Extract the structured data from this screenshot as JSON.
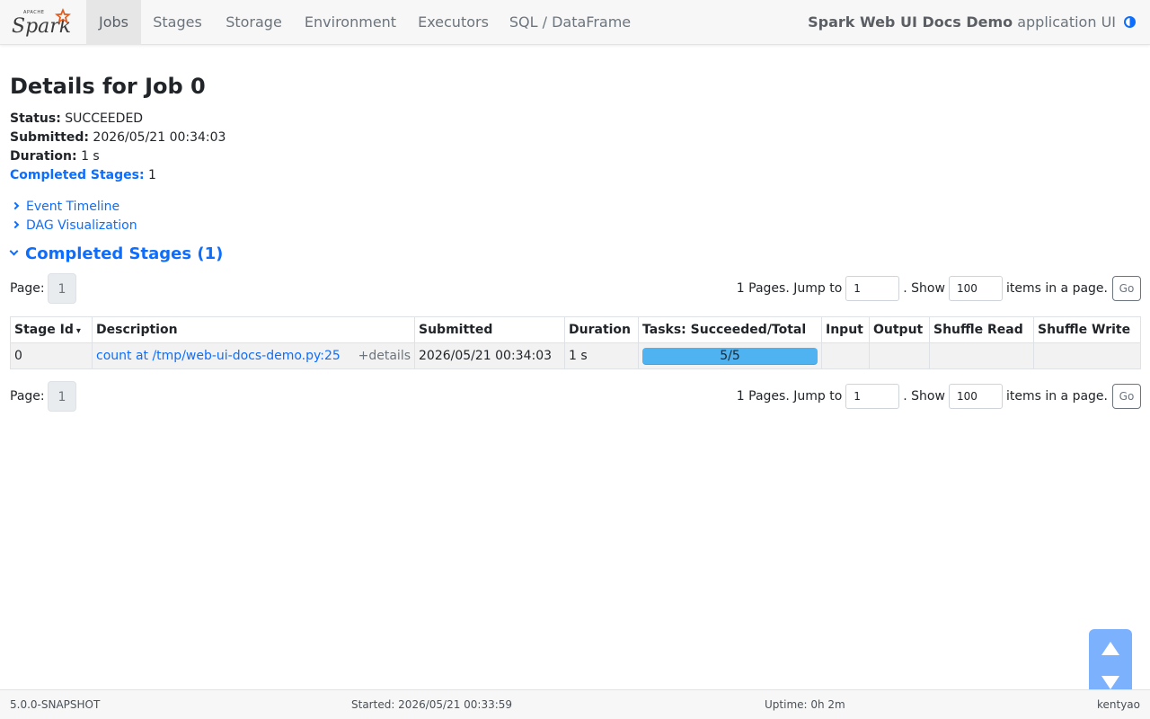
{
  "navbar": {
    "brand": "Spark",
    "brand_small": "APACHE",
    "tabs": [
      "Jobs",
      "Stages",
      "Storage",
      "Environment",
      "Executors",
      "SQL / DataFrame"
    ],
    "active_tab": "Jobs",
    "app_name": "Spark Web UI Docs Demo",
    "app_suffix": "application UI"
  },
  "page": {
    "title": "Details for Job 0",
    "status_label": "Status:",
    "status_value": "SUCCEEDED",
    "submitted_label": "Submitted:",
    "submitted_value": "2026/05/21 00:34:03",
    "duration_label": "Duration:",
    "duration_value": "1 s",
    "completed_label": "Completed Stages:",
    "completed_value": "1",
    "event_timeline": "Event Timeline",
    "dag_visualization": "DAG Visualization",
    "section_title": "Completed Stages (1)"
  },
  "pager": {
    "page_label": "Page:",
    "current_page": "1",
    "pages_text": "1 Pages. Jump to",
    "jump_value": "1",
    "show_text": ". Show",
    "show_value": "100",
    "items_text": "items in a page.",
    "go_label": "Go"
  },
  "table": {
    "headers": [
      "Stage Id",
      "Description",
      "Submitted",
      "Duration",
      "Tasks: Succeeded/Total",
      "Input",
      "Output",
      "Shuffle Read",
      "Shuffle Write"
    ],
    "sort_arrow": "▾",
    "rows": [
      {
        "stage_id": "0",
        "description": "count at /tmp/web-ui-docs-demo.py:25",
        "details": "+details",
        "submitted": "2026/05/21 00:34:03",
        "duration": "1 s",
        "tasks": "5/5",
        "tasks_fraction": 1.0,
        "input": "",
        "output": "",
        "shuffle_read": "",
        "shuffle_write": ""
      }
    ]
  },
  "footer": {
    "version": "5.0.0-SNAPSHOT",
    "started": "Started: 2026/05/21 00:33:59",
    "uptime": "Uptime: 0h 2m",
    "user": "kentyao"
  },
  "colors": {
    "link": "#0d6efd",
    "progress": "#4fb3f2",
    "spark_orange": "#e25a1c"
  }
}
